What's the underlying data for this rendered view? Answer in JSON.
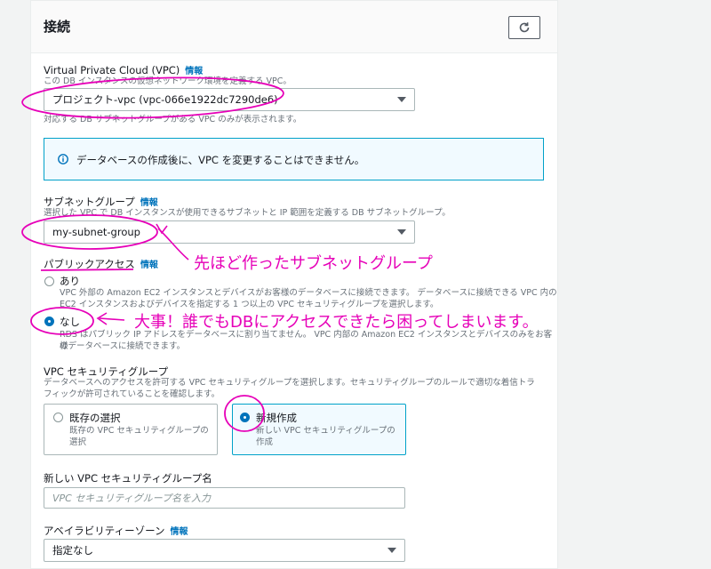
{
  "section": {
    "title": "接続"
  },
  "vpc": {
    "label": "Virtual Private Cloud (VPC)",
    "info": "情報",
    "description": "この DB インスタンスの仮想ネットワーク環境を定義する VPC。",
    "selected": "プロジェクト-vpc (vpc-066e1922dc7290de6)",
    "hint": "対応する DB サブネットグループがある VPC のみが表示されます。",
    "alert": "データベースの作成後に、VPC を変更することはできません。"
  },
  "subnet": {
    "label": "サブネットグループ",
    "info": "情報",
    "description": "選択した VPC で DB インスタンスが使用できるサブネットと IP 範囲を定義する DB サブネットグループ。",
    "selected": "my-subnet-group"
  },
  "public_access": {
    "label": "パブリックアクセス",
    "info": "情報",
    "options": [
      {
        "label": "あり",
        "desc1": "VPC 外部の Amazon EC2 インスタンスとデバイスがお客様のデータベースに接続できます。 データベースに接続できる VPC 内の",
        "desc2": "EC2 インスタンスおよびデバイスを指定する 1 つ以上の VPC セキュリティグループを選択します。"
      },
      {
        "label": "なし",
        "desc1": "RDS はパブリック IP アドレスをデータベースに割り当てません。 VPC 内部の Amazon EC2 インスタンスとデバイスのみをお客様",
        "desc2": "のデータベースに接続できます。"
      }
    ],
    "selected_index": 1
  },
  "security_group": {
    "label": "VPC セキュリティグループ",
    "desc1": "データベースへのアクセスを許可する VPC セキュリティグループを選択します。セキュリティグループのルールで適切な着信トラ",
    "desc2": "フィックが許可されていることを確認します。",
    "tiles": [
      {
        "title": "既存の選択",
        "sub1": "既存の VPC セキュリティグループの",
        "sub2": "選択"
      },
      {
        "title": "新規作成",
        "sub1": "新しい VPC セキュリティグループの",
        "sub2": "作成"
      }
    ],
    "selected_index": 1
  },
  "new_sg": {
    "label": "新しい VPC セキュリティグループ名",
    "placeholder": "VPC セキュリティグループ名を入力"
  },
  "az": {
    "label": "アベイラビリティーゾーン",
    "info": "情報",
    "selected": "指定なし"
  },
  "annotations": {
    "subnet_note": "先ほど作ったサブネットグループ",
    "access_note": "大事！誰でもDBにアクセスできたら困ってしまいます。"
  },
  "colors": {
    "annotation": "#e600b8",
    "accent": "#0073bb"
  }
}
